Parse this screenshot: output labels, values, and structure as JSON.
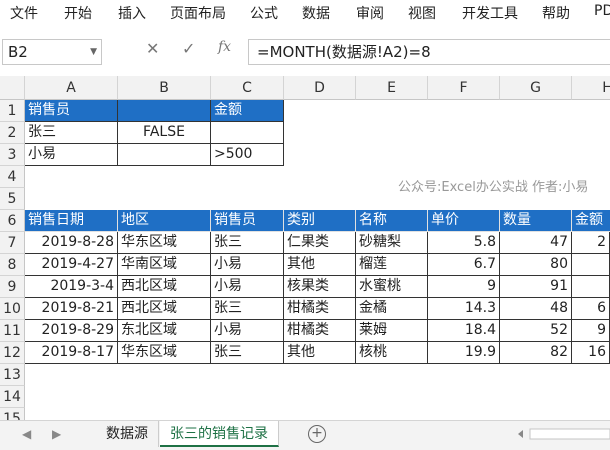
{
  "ribbon": {
    "tabs": [
      "文件",
      "开始",
      "插入",
      "页面布局",
      "公式",
      "数据",
      "审阅",
      "视图",
      "开发工具",
      "帮助",
      "PD"
    ]
  },
  "formula_bar": {
    "name_box": "B2",
    "cancel_icon": "✕",
    "enter_icon": "✓",
    "fx_label": "fx",
    "formula": "=MONTH(数据源!A2)=8"
  },
  "columns": [
    "A",
    "B",
    "C",
    "D",
    "E",
    "F",
    "G",
    "H"
  ],
  "rows": [
    "1",
    "2",
    "3",
    "4",
    "5",
    "6",
    "7",
    "8",
    "9",
    "10",
    "11",
    "12",
    "13",
    "14",
    "15"
  ],
  "criteria": {
    "r1": [
      "销售员",
      "",
      "金额"
    ],
    "r2": [
      "张三",
      "FALSE",
      ""
    ],
    "r3": [
      "小易",
      "",
      ">500"
    ]
  },
  "watermark": "公众号:Excel办公实战 作者:小易",
  "table": {
    "headers": [
      "销售日期",
      "地区",
      "销售员",
      "类别",
      "名称",
      "单价",
      "数量",
      "金额"
    ],
    "rows": [
      [
        "2019-8-28",
        "华东区域",
        "张三",
        "仁果类",
        "砂糖梨",
        "5.8",
        "47",
        "2"
      ],
      [
        "2019-4-27",
        "华南区域",
        "小易",
        "其他",
        "榴莲",
        "6.7",
        "80",
        ""
      ],
      [
        "2019-3-4",
        "西北区域",
        "小易",
        "核果类",
        "水蜜桃",
        "9",
        "91",
        ""
      ],
      [
        "2019-8-21",
        "西北区域",
        "张三",
        "柑橘类",
        "金橘",
        "14.3",
        "48",
        "6"
      ],
      [
        "2019-8-29",
        "东北区域",
        "小易",
        "柑橘类",
        "莱姆",
        "18.4",
        "52",
        "9"
      ],
      [
        "2019-8-17",
        "华东区域",
        "张三",
        "其他",
        "核桃",
        "19.9",
        "82",
        "16"
      ]
    ]
  },
  "sheet_tabs": [
    "数据源",
    "张三的销售记录"
  ],
  "add_sheet_icon": "+"
}
